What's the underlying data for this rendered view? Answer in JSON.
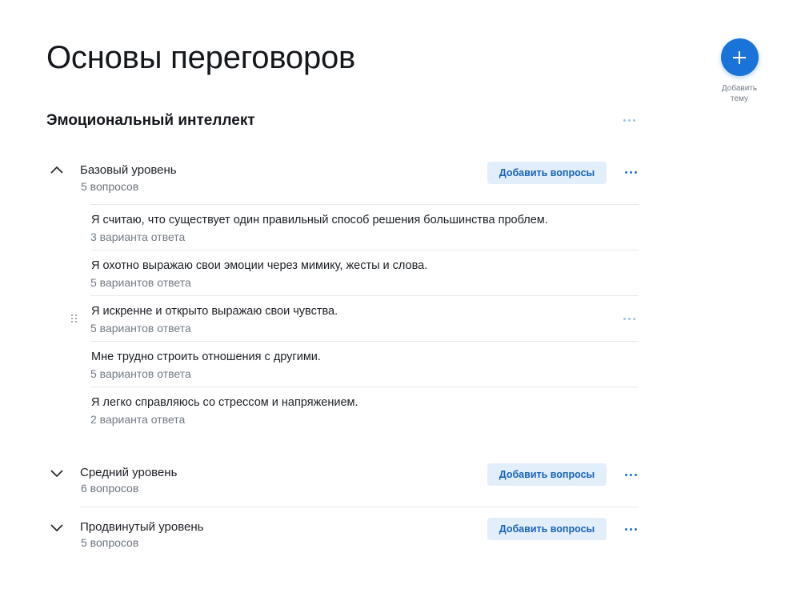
{
  "page": {
    "title": "Основы переговоров"
  },
  "add_topic": {
    "label": "Добавить тему",
    "icon": "plus-icon",
    "color": "#1a73d9"
  },
  "section": {
    "title": "Эмоциональный интеллект"
  },
  "levels": [
    {
      "title": "Базовый уровень",
      "count": "5 вопросов",
      "expanded": true,
      "add_label": "Добавить вопросы",
      "questions": [
        {
          "text": "Я считаю, что существует один правильный способ решения большинства проблем.",
          "answers": "3 варианта ответа"
        },
        {
          "text": "Я охотно выражаю свои эмоции через мимику, жесты и слова.",
          "answers": "5 вариантов ответа"
        },
        {
          "text": "Я искренне и открыто выражаю свои чувства.",
          "answers": "5 вариантов ответа"
        },
        {
          "text": "Мне трудно строить отношения с другими.",
          "answers": "5 вариантов ответа"
        },
        {
          "text": "Я легко справляюсь со стрессом и напряжением.",
          "answers": "2 варианта ответа"
        }
      ]
    },
    {
      "title": "Средний уровень",
      "count": "6 вопросов",
      "expanded": false,
      "add_label": "Добавить вопросы"
    },
    {
      "title": "Продвинутый уровень",
      "count": "5 вопросов",
      "expanded": false,
      "add_label": "Добавить вопросы"
    }
  ],
  "colors": {
    "accent": "#1a73d9",
    "button_bg": "#e3eefb",
    "muted": "#737b85",
    "divider": "#e6e8eb"
  }
}
